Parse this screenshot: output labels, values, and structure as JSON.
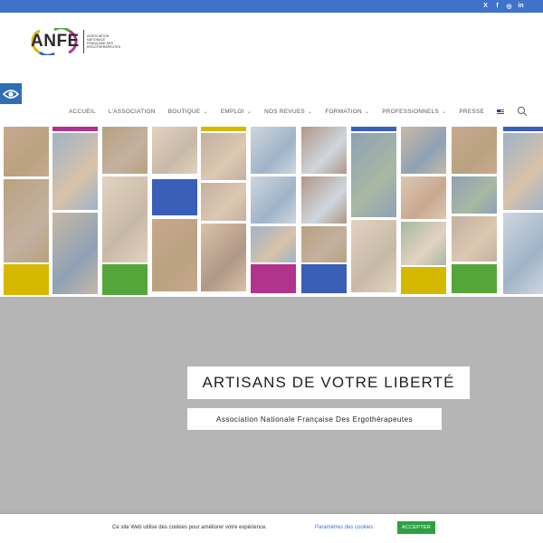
{
  "social": {
    "icons": [
      "x-icon",
      "facebook-icon",
      "instagram-icon",
      "linkedin-icon"
    ],
    "glyphs": [
      "X",
      "f",
      "◎",
      "in"
    ]
  },
  "logo": {
    "word": "ANFE",
    "subtitle": "ASSOCIATION NATIONALE FRANÇAISE DES ERGOTHÉRAPEUTES"
  },
  "nav": {
    "items": [
      {
        "label": "ACCUEIL",
        "dropdown": false
      },
      {
        "label": "L'ASSOCIATION",
        "dropdown": false
      },
      {
        "label": "BOUTIQUE",
        "dropdown": true
      },
      {
        "label": "EMPLOI",
        "dropdown": true
      },
      {
        "label": "NOS REVUES",
        "dropdown": true
      },
      {
        "label": "FORMATION",
        "dropdown": true
      },
      {
        "label": "PROFESSIONNELS",
        "dropdown": true
      },
      {
        "label": "PRESSE",
        "dropdown": false
      }
    ],
    "chevron": "⌄"
  },
  "hero": {
    "title": "ARTISANS DE VOTRE LIBERTÉ",
    "subtitle": "Association Nationale Française Des Ergothérapeutes"
  },
  "cookie": {
    "text": "Ce site Web utilise des cookies pour améliorer votre expérience.",
    "settings_link": "Paramètres des cookies",
    "accept_label": "ACCEPTER"
  },
  "colors": {
    "topbar": "#3f72c9",
    "hero_bg": "#b5b5b5",
    "accept": "#2ea043",
    "mosaic_blue": "#3a5fb8",
    "mosaic_yellow": "#d6b800",
    "mosaic_magenta": "#b2338c",
    "mosaic_green": "#55a63a"
  }
}
